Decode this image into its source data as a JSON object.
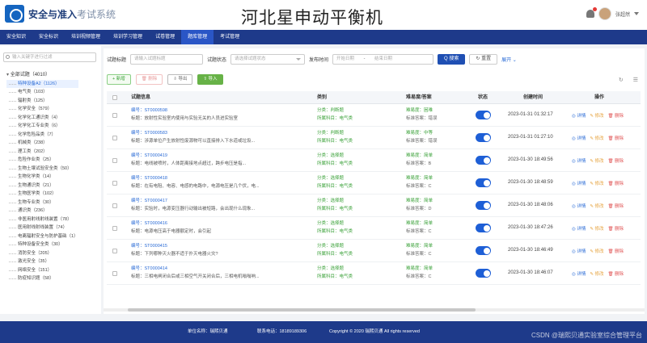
{
  "header": {
    "logo_main": "安全与准入",
    "logo_sub": "考试系统",
    "overlay_title": "河北星申动平衡机",
    "username": "张超然"
  },
  "nav": [
    "安全知识",
    "安全标识",
    "培训视频管理",
    "培训学习管理",
    "试卷管理",
    "题库管理",
    "考试管理"
  ],
  "nav_active_index": 5,
  "sidebar": {
    "search_placeholder": "输入关键字进行过滤",
    "root": "全部试题（4010）",
    "items": [
      "特种设备A2（1126）",
      "电气类（103）",
      "辐射类（125）",
      "化学安全（579）",
      "化学化工通识类（4）",
      "化学化工专业类（6）",
      "化学危险品类（7）",
      "机械类（238）",
      "理工类（202）",
      "危险作业类（25）",
      "生物土壤试验安全类（50）",
      "生物化学类（14）",
      "生物通识类（21）",
      "生物医学类（102）",
      "生物专业类（30）",
      "通识类（236）",
      "非医用射线射线装置（78）",
      "医用射线射线装置（74）",
      "电离辐射安全与防护基础（1）",
      "特种设备安全类（30）",
      "消防安全（205）",
      "激光安全（35）",
      "网络安全（151）",
      "防疫知识题（58）"
    ],
    "selected_index": 0
  },
  "filters": {
    "title_label": "试题标题",
    "title_placeholder": "请输入试题标题",
    "status_label": "试题状态",
    "status_placeholder": "请选择试题状态",
    "time_label": "发布时间",
    "start_placeholder": "开始日期",
    "dash": "-",
    "end_placeholder": "结束日期",
    "search_btn": "Q 搜索",
    "reset_btn": "↻ 重置",
    "expand": "展开 ⌄"
  },
  "actions": {
    "add": "+ 新增",
    "delete": "🗑 删除",
    "export": "⇩ 导出",
    "import": "⇧ 导入"
  },
  "table": {
    "headers": [
      "试题信息",
      "类别",
      "难易度/答案",
      "状态",
      "创建时间",
      "操作"
    ],
    "op_detail": "◎ 详情",
    "op_edit": "✎ 修改",
    "op_delete": "🗑 删除",
    "rows": [
      {
        "id": "编号：ST0000598",
        "title": "标题：放射性实验室内使用与实验无关的人员进实验室",
        "cat": "分类：判断题",
        "subject": "所属科目：电气类",
        "diff": "难易度：困难",
        "answer": "标准答案：错误",
        "time": "2023-01-31 01:32:17"
      },
      {
        "id": "编号：ST0000583",
        "title": "标题：涉源单位产生放射性废源物可以直接排入下水道或垃圾...",
        "cat": "分类：判断题",
        "subject": "所属科目：电气类",
        "diff": "难易度：中等",
        "answer": "标准答案：错误",
        "time": "2023-01-31 01:27:10"
      },
      {
        "id": "编号：ST0000419",
        "title": "标题：电线被喷时，人体距离接地点超过，跨步电压是指...",
        "cat": "分类：选择题",
        "subject": "所属科目：电气类",
        "diff": "难易度：简单",
        "answer": "标准答案：B",
        "time": "2023-01-30 18:49:56"
      },
      {
        "id": "编号：ST0000418",
        "title": "标题：在有电阻、电容、电感的电路中，电源电压是几个伏，电...",
        "cat": "分类：选择题",
        "subject": "所属科目：电气类",
        "diff": "难易度：简单",
        "answer": "标准答案：C",
        "time": "2023-01-30 18:48:59"
      },
      {
        "id": "编号：ST0000417",
        "title": "标题：实验时，电源变压器行动输出被短路，会出现什么现象...",
        "cat": "分类：选择题",
        "subject": "所属科目：电气类",
        "diff": "难易度：简单",
        "answer": "标准答案：D",
        "time": "2023-01-30 18:48:06"
      },
      {
        "id": "编号：ST0000416",
        "title": "标题：电源电压高于电器额定时，会引起",
        "cat": "分类：选择题",
        "subject": "所属科目：电气类",
        "diff": "难易度：简单",
        "answer": "标准答案：C",
        "time": "2023-01-30 18:47:26"
      },
      {
        "id": "编号：ST0000415",
        "title": "标题：下列哪种灭火器不适于扑灭电器火灾?",
        "cat": "分类：选择题",
        "subject": "所属科目：电气类",
        "diff": "难易度：简单",
        "answer": "标准答案：C",
        "time": "2023-01-30 18:46:49"
      },
      {
        "id": "编号：ST0000414",
        "title": "标题：三相电闸闭合后或三相空气开关闭合后，三相电机嗡嗡响...",
        "cat": "分类：选择题",
        "subject": "所属科目：电气类",
        "diff": "难易度：简单",
        "answer": "标准答案：C",
        "time": "2023-01-30 18:46:07"
      }
    ]
  },
  "footer": {
    "unit": "单位名称：瑞熙贝通",
    "phone": "联系电话：18189189306",
    "copyright": "Copyright © 2020 瑞熙贝通 All rights reserved",
    "watermark": "CSDN @瑞熙贝通实验室综合管理平台"
  }
}
